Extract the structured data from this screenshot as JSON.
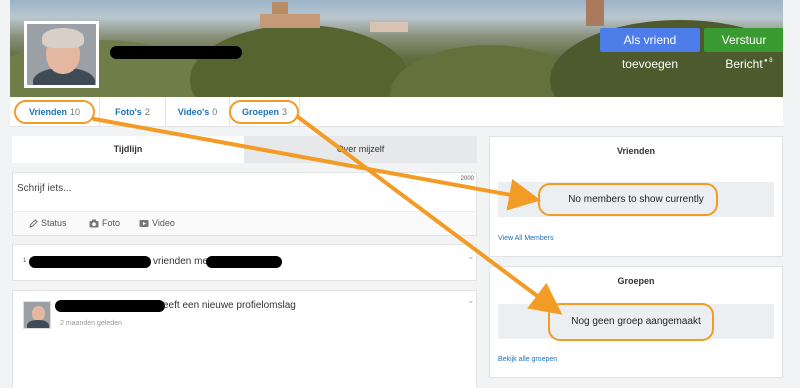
{
  "profile": {
    "add_friend_button": "Als vriend toevoegen",
    "send_message_button": "Verstuur Bericht",
    "views": "8"
  },
  "tabs": [
    {
      "label": "Vrienden",
      "count": "10"
    },
    {
      "label": "Foto's",
      "count": "2"
    },
    {
      "label": "Video's",
      "count": "0"
    },
    {
      "label": "Groepen",
      "count": "3"
    }
  ],
  "timeline": {
    "tab_timeline": "Tijdlijn",
    "tab_about": "Over mijzelf",
    "composer_placeholder": "Schrijf iets...",
    "char_limit": "2000",
    "actions": {
      "status": "Status",
      "photo": "Foto",
      "video": "Video"
    }
  },
  "feed": [
    {
      "text_fragment": "vrienden me",
      "bullet": "1"
    },
    {
      "text_fragment": "eeft een nieuwe profielomslag",
      "time": "2 maanden geleden"
    }
  ],
  "friends_panel": {
    "title": "Vrienden",
    "empty_text": "No members to show currently",
    "link": "View All Members"
  },
  "groups_panel": {
    "title": "Groepen",
    "empty_text": "Nog geen groep aangemaakt",
    "link": "Bekijk alle groepen"
  },
  "colors": {
    "link_blue": "#1f73b7",
    "add_friend_bg": "#4c7de8",
    "send_message_bg": "#3a9a32",
    "annotation_orange": "#f29b25"
  }
}
